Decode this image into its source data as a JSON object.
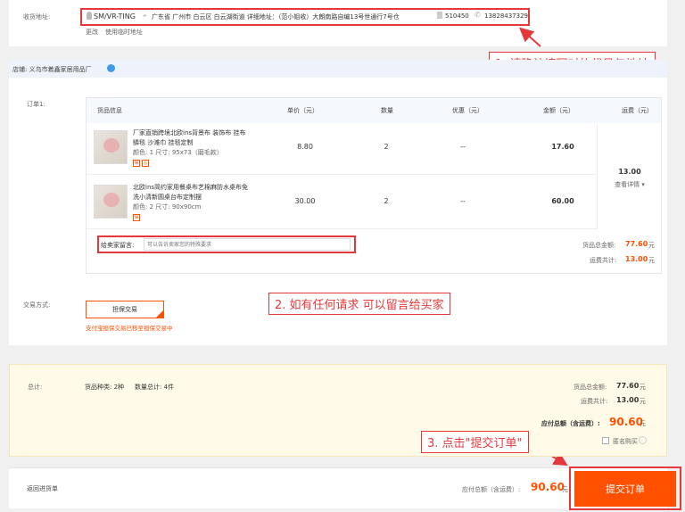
{
  "address": {
    "label": "收货地址:",
    "name": "SM/VR-TING",
    "location": "广东省 广州市 白云区 白云湖街道 详细地址：（范小姐收）大朗南路自编13号世通行7号仓",
    "zip": "510450",
    "phone": "13828437329",
    "change_link": "更改",
    "temp_link": "使用临时地址"
  },
  "callouts": {
    "one": "1. 请确认填写对的代号与地址",
    "two": "2. 如有任何请求 可以留言给买家",
    "three": "3. 点击\"提交订单\""
  },
  "store": {
    "label": "店铺: 义乌市着鑫家居用品厂"
  },
  "order": {
    "label": "订单1:",
    "headers": {
      "product": "货品信息",
      "price": "单价（元）",
      "qty": "数量",
      "discount": "优惠（元）",
      "amount": "金额（元）",
      "shipping": "运费（元）"
    },
    "items": [
      {
        "title_line1": "厂家直销跨境北欧ins背景布 装饰布 挂布",
        "title_line2": "鳞毯 沙滩巾 挂毯定制",
        "spec": "颜色: 1    尺寸: 95x73（磨毛款）",
        "price": "8.80",
        "qty": "2",
        "discount": "--",
        "amount": "17.60"
      },
      {
        "title_line1": "北欧ins简约家用餐桌布艺棉麻防水桌布免",
        "title_line2": "洗小清新圆桌台布定制摆",
        "spec": "颜色: 2    尺寸: 90x90cm",
        "price": "30.00",
        "qty": "2",
        "discount": "--",
        "amount": "60.00"
      }
    ],
    "shipping_fee": "13.00",
    "shipping_detail": "查看详情 ▾",
    "message_label": "给卖家留言:",
    "message_placeholder": "可以告诉卖家您的特殊要求",
    "goods_total_label": "货品总金额:",
    "goods_total": "77.60",
    "shipping_total_label": "运费共计:",
    "shipping_total": "13.00",
    "unit": "元"
  },
  "trade": {
    "label": "交易方式:",
    "option": "担保交易",
    "note": "支付宝担保交易已移至担保交易中"
  },
  "summary": {
    "label": "总计:",
    "kinds": "货品种类: 2种",
    "count": "数量总计: 4件",
    "goods_total_label": "货品总金额:",
    "goods_total": "77.60",
    "shipping_label": "运费共计:",
    "shipping": "13.00",
    "payable_label": "应付总额（含运费）:",
    "payable": "90.60",
    "unit": "元",
    "anonymous": "匿名购买"
  },
  "footer": {
    "back": "返回进货单",
    "payable_label": "应付总额（含运费）:",
    "payable": "90.60",
    "unit": "元",
    "submit": "提交订单"
  },
  "colors": {
    "accent": "#ff5000",
    "annotation": "#e4393c",
    "store_bar": "#eef3fb",
    "summary_bg": "#fffbe8"
  }
}
